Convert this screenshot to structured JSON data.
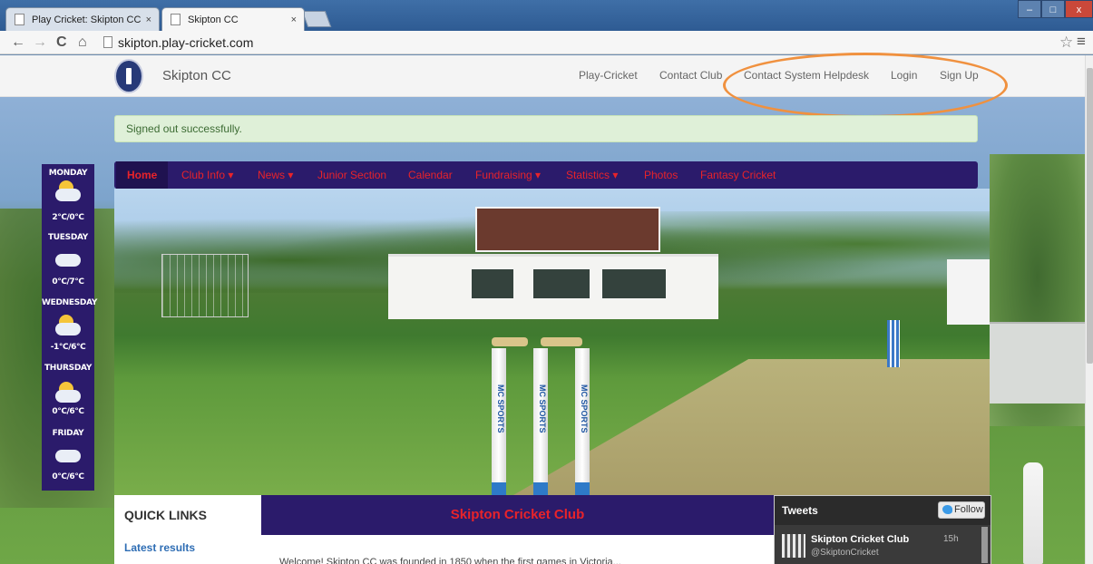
{
  "browser": {
    "tabs": [
      {
        "title": "Play Cricket: Skipton CC",
        "close": "×"
      },
      {
        "title": "Skipton CC",
        "close": "×"
      }
    ],
    "window_controls": {
      "minimize": "–",
      "maximize": "□",
      "close": "x"
    },
    "address": "skipton.play-cricket.com",
    "nav_icons": {
      "back": "←",
      "forward": "→",
      "reload": "C",
      "home": "⌂",
      "star": "☆",
      "menu": "≡"
    }
  },
  "site": {
    "name": "Skipton CC",
    "header_nav": [
      "Play-Cricket",
      "Contact Club",
      "Contact System Helpdesk",
      "Login",
      "Sign Up"
    ],
    "alert": "Signed out successfully.",
    "main_nav": [
      "Home",
      "Club Info ▾",
      "News ▾",
      "Junior Section",
      "Calendar",
      "Fundraising ▾",
      "Statistics ▾",
      "Photos",
      "Fantasy Cricket"
    ],
    "stump_text": "MC SPORTS"
  },
  "weather": [
    {
      "day": "MONDAY",
      "temp": "2°C/0°C"
    },
    {
      "day": "TUESDAY",
      "temp": "0°C/7°C"
    },
    {
      "day": "WEDNESDAY",
      "temp": "-1°C/6°C"
    },
    {
      "day": "THURSDAY",
      "temp": "0°C/6°C"
    },
    {
      "day": "FRIDAY",
      "temp": "0°C/6°C"
    }
  ],
  "quick_links": {
    "title": "QUICK LINKS",
    "items": [
      "Latest results"
    ]
  },
  "main": {
    "title": "Skipton Cricket Club",
    "intro": "Welcome! Skipton CC was founded in 1850 when the first games in Victoria..."
  },
  "tweets": {
    "title": "Tweets",
    "follow": "Follow",
    "items": [
      {
        "name": "Skipton Cricket Club",
        "handle": "@SkiptonCricket",
        "time": "15h"
      }
    ]
  },
  "colors": {
    "nav_bg": "#2b1b6b",
    "nav_text": "#e8232a",
    "alert_bg": "#dff0d8",
    "annotation": "#f0913f"
  }
}
